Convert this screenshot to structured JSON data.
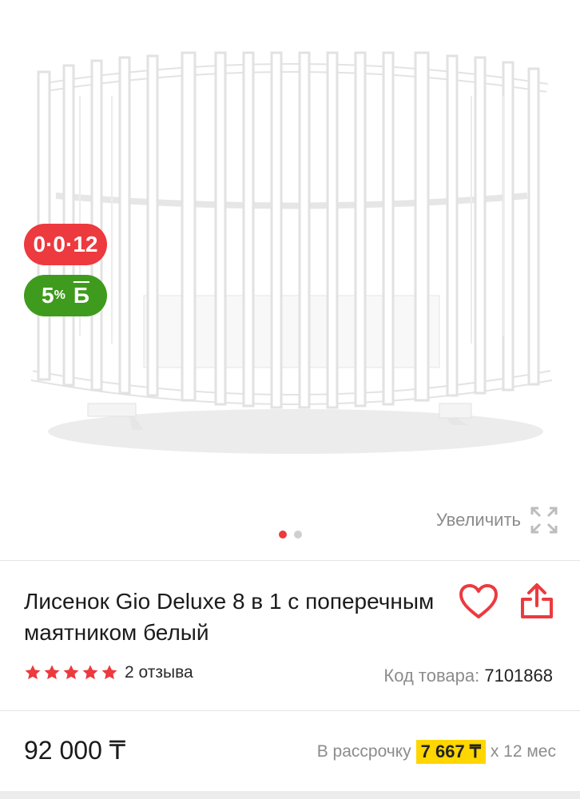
{
  "badges": {
    "installment": "0·0·12",
    "bonus_percent": "5",
    "bonus_sign": "%",
    "bonus_letter": "Б"
  },
  "gallery": {
    "zoom_label": "Увеличить",
    "dots_total": 2,
    "dots_active": 1
  },
  "product": {
    "title": "Лисенок Gio Deluxe 8 в 1 с поперечным маятником белый",
    "rating_stars": 5,
    "reviews": "2 отзыва",
    "sku_label": "Код товара:",
    "sku_value": "7101868",
    "price": "92 000 ₸",
    "installment_prefix": "В рассрочку",
    "installment_amount": "7 667 ₸",
    "installment_suffix": "x 12 мес"
  },
  "colors": {
    "accent_red": "#ec3a3f",
    "bonus_green": "#3f9b1d",
    "installment_yellow": "#ffd600"
  },
  "icons": [
    "heart-icon",
    "share-icon",
    "expand-icon",
    "star-icon"
  ]
}
